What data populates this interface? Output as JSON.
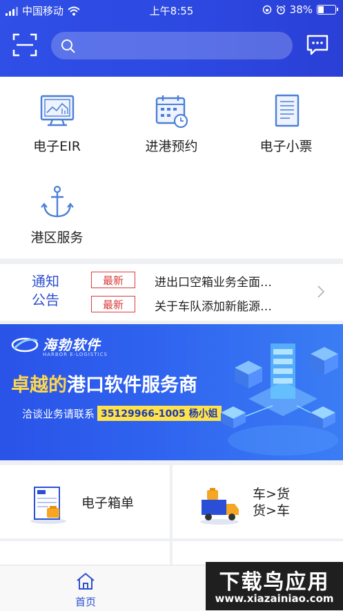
{
  "status_bar": {
    "carrier": "中国移动",
    "time": "上午8:55",
    "battery_text": "38%",
    "battery_level": 0.38
  },
  "search": {
    "placeholder": ""
  },
  "quick_grid": [
    {
      "label": "电子EIR",
      "icon": "monitor-chart-icon"
    },
    {
      "label": "进港预约",
      "icon": "calendar-clock-icon"
    },
    {
      "label": "电子小票",
      "icon": "document-list-icon"
    },
    {
      "label": "港区服务",
      "icon": "anchor-icon"
    }
  ],
  "notice": {
    "title_line1": "通知",
    "title_line2": "公告",
    "items": [
      {
        "badge": "最新",
        "text": "进出口空箱业务全面…"
      },
      {
        "badge": "最新",
        "text": "关于车队添加新能源…"
      }
    ]
  },
  "banner": {
    "logo_text": "海勃软件",
    "logo_sub": "HARBOR E-LOGISTICS",
    "slogan_highlight": "卓越的",
    "slogan_rest": "港口软件服务商",
    "contact_prefix": "洽谈业务请联系",
    "contact_value": "35129966-1005 杨小姐"
  },
  "tiles": [
    {
      "label": "电子箱单",
      "icon": "box-document-icon"
    },
    {
      "label_line1": "车>货",
      "label_line2": "货>车",
      "icon": "truck-cargo-icon"
    }
  ],
  "tabbar": {
    "home_label": "首页"
  },
  "watermark": {
    "title": "下载鸟应用",
    "url": "www.xiazainiao.com"
  },
  "colors": {
    "brand_blue": "#2f4fe6",
    "notice_badge": "#d83b3b",
    "banner_highlight": "#ffd84a"
  }
}
